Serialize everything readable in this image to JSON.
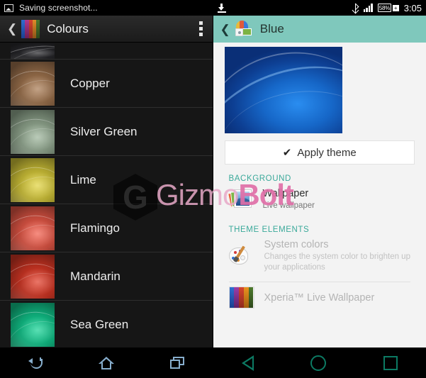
{
  "left_panel": {
    "status_bar": {
      "notification_text": "Saving screenshot...",
      "notification_icon": "screenshot-icon"
    },
    "app_bar": {
      "back_icon": "back-chevron-icon",
      "app_icon": "themes-icon",
      "title": "Colours",
      "overflow_icon": "overflow-menu-icon"
    },
    "theme_list": [
      {
        "label": "",
        "color": "#2a2a2e",
        "partial": true
      },
      {
        "label": "Copper",
        "color": "#a87a52"
      },
      {
        "label": "Silver Green",
        "color": "#9cb49a"
      },
      {
        "label": "Lime",
        "color": "#e0d23c"
      },
      {
        "label": "Flamingo",
        "color": "#f25c4a"
      },
      {
        "label": "Mandarin",
        "color": "#e03a26"
      },
      {
        "label": "Sea Green",
        "color": "#12d193"
      }
    ],
    "nav_bar": {
      "back": "back-icon",
      "home": "home-icon",
      "recents": "recents-icon",
      "color": "#8fb8d8"
    }
  },
  "right_panel": {
    "status_bar": {
      "download_icon": "download-icon",
      "bluetooth_icon": "bluetooth-icon",
      "signal_icon": "signal-bars-icon",
      "battery_text": "58%",
      "battery_plus": "+",
      "time": "3:05"
    },
    "app_bar": {
      "back_icon": "back-chevron-icon",
      "app_icon": "palette-themes-icon",
      "title": "Blue",
      "bg_color": "#7fc8bc"
    },
    "preview": {
      "name": "theme-preview-blue"
    },
    "apply_button": {
      "check_icon": "check-icon",
      "label": "Apply theme"
    },
    "sections": [
      {
        "header": "BACKGROUND",
        "items": [
          {
            "icon": "wallpaper-stack-icon",
            "title": "Wallpaper",
            "subtitle": "Live wallpaper",
            "disabled": false
          }
        ]
      },
      {
        "header": "THEME ELEMENTS",
        "items": [
          {
            "icon": "palette-brush-icon",
            "title": "System colors",
            "subtitle": "Changes the system color to brighten up your applications",
            "disabled": true
          },
          {
            "icon": "xperia-stripes-icon",
            "title": "Xperia™ Live Wallpaper",
            "subtitle": "",
            "disabled": true
          }
        ]
      }
    ],
    "nav_bar": {
      "back": "back-triangle-icon",
      "home": "home-circle-icon",
      "recents": "recents-square-icon",
      "color": "#0c7a63"
    }
  },
  "watermark": {
    "part1": "Gizmo",
    "part2": "Bolt",
    "mark": "G"
  }
}
